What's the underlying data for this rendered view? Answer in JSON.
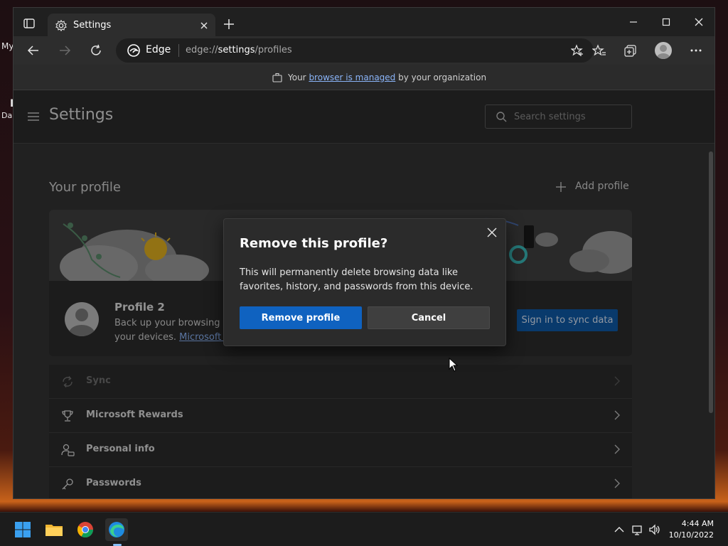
{
  "desktop": {
    "fragment_1": "My",
    "fragment_2": "I",
    "fragment_3": "Da"
  },
  "browser": {
    "tab": {
      "title": "Settings"
    },
    "address": {
      "brand": "Edge",
      "url_prefix": "edge://",
      "url_host": "settings",
      "url_path": "/profiles"
    },
    "managed_bar": {
      "prefix": "Your ",
      "link": "browser is managed",
      "suffix": " by your organization"
    }
  },
  "settings": {
    "title": "Settings",
    "search_placeholder": "Search settings",
    "section_title": "Your profile",
    "add_profile_label": "Add profile",
    "profile": {
      "name": "Profile 2",
      "desc_line1": "Back up your browsing d",
      "desc_line2_prefix": "your devices. ",
      "desc_link": "Microsoft R",
      "sign_in_label": "Sign in to sync data"
    },
    "list": [
      {
        "label": "Sync",
        "icon": "sync-icon",
        "disabled": true
      },
      {
        "label": "Microsoft Rewards",
        "icon": "trophy-icon",
        "disabled": false
      },
      {
        "label": "Personal info",
        "icon": "person-info-icon",
        "disabled": false
      },
      {
        "label": "Passwords",
        "icon": "key-icon",
        "disabled": false
      }
    ]
  },
  "dialog": {
    "title": "Remove this profile?",
    "body": "This will permanently delete browsing data like favorites, history, and passwords from this device.",
    "primary_label": "Remove profile",
    "secondary_label": "Cancel"
  },
  "taskbar": {
    "apps": [
      "windows-start-icon",
      "file-explorer-icon",
      "chrome-icon",
      "edge-icon"
    ],
    "time": "4:44 AM",
    "date": "10/10/2022"
  },
  "colors": {
    "accent_blue": "#0f62c0",
    "link_blue": "#8ab4f8",
    "window_bg": "#1f1f1f",
    "page_bg": "#333333"
  }
}
